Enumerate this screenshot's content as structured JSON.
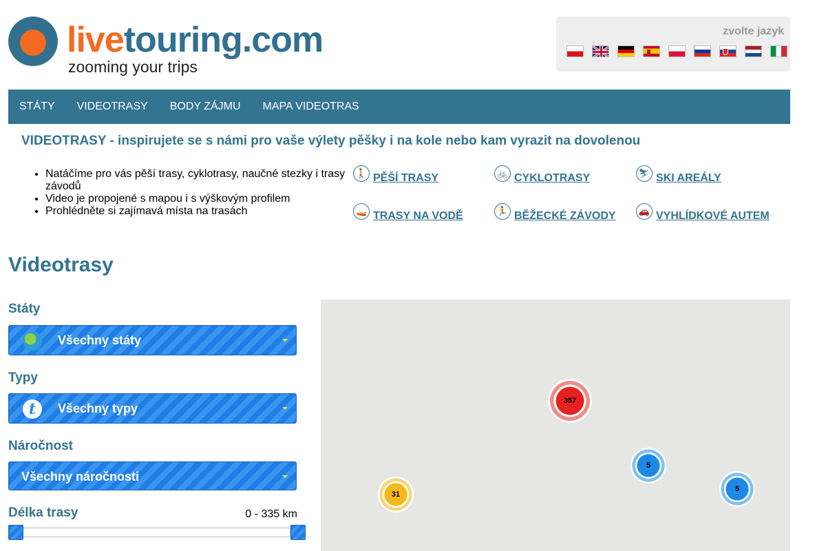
{
  "logo": {
    "word_part1": "live",
    "word_part2": "touring.com",
    "tagline": "zooming your trips"
  },
  "language": {
    "title": "zvolte jazyk",
    "flags": [
      {
        "code": "cz",
        "name": "cz-flag-icon"
      },
      {
        "code": "gb",
        "name": "gb-flag-icon"
      },
      {
        "code": "de",
        "name": "de-flag-icon"
      },
      {
        "code": "es",
        "name": "es-flag-icon"
      },
      {
        "code": "pl",
        "name": "pl-flag-icon"
      },
      {
        "code": "ru",
        "name": "ru-flag-icon"
      },
      {
        "code": "sk",
        "name": "sk-flag-icon"
      },
      {
        "code": "nl",
        "name": "nl-flag-icon"
      },
      {
        "code": "it",
        "name": "it-flag-icon"
      }
    ]
  },
  "nav": {
    "items": [
      "STÁTY",
      "VIDEOTRASY",
      "BODY ZÁJMU",
      "MAPA VIDEOTRAS"
    ]
  },
  "intro": {
    "title": "VIDEOTRASY - inspirujete se s námi pro vaše výlety pěšky i na kole nebo kam vyrazit na dovolenou",
    "bullets": [
      "Natáčíme pro vás pěší trasy, cyklotrasy, naučné stezky i trasy závodů",
      "Video je propojené s mapou i s výškovým profilem",
      "Prohlédněte si zajímavá místa na trasách"
    ]
  },
  "categories": [
    {
      "label": "PĚŠÍ TRASY",
      "icon": "hiker-icon",
      "glyph": "🚶"
    },
    {
      "label": "CYKLOTRASY",
      "icon": "bicycle-icon",
      "glyph": "🚲"
    },
    {
      "label": "SKI AREÁLY",
      "icon": "skier-icon",
      "glyph": "⛷"
    },
    {
      "label": "TRASY NA VODĚ",
      "icon": "boat-icon",
      "glyph": "🚤"
    },
    {
      "label": "BĚŽECKÉ ZÁVODY",
      "icon": "runner-icon",
      "glyph": "🏃"
    },
    {
      "label": "VYHLÍDKOVÉ AUTEM",
      "icon": "car-icon",
      "glyph": "🚗"
    }
  ],
  "main": {
    "title": "Videotrasy"
  },
  "filters": {
    "states_label": "Státy",
    "states_value": "Všechny státy",
    "types_label": "Typy",
    "types_value": "Všechny typy",
    "types_icon_glyph": "t",
    "difficulty_label": "Náročnost",
    "difficulty_value": "Všechny náročnosti",
    "length_label": "Délka trasy",
    "length_value": "0 - 335 km",
    "length_min_fraction": 0,
    "length_max_fraction": 1
  },
  "map": {
    "clusters": [
      {
        "count": "357",
        "color": "#e8211e",
        "ring": "#f08c85"
      },
      {
        "count": "5",
        "color": "#1e88e5",
        "ring": "#7ec0f2"
      },
      {
        "count": "5",
        "color": "#1e88e5",
        "ring": "#7ec0f2"
      },
      {
        "count": "31",
        "color": "#f6b81c",
        "ring": "#f8d675"
      }
    ]
  },
  "colors": {
    "brand_blue": "#337491",
    "brand_orange": "#f26b21",
    "select_blue": "#1e7ee6"
  }
}
